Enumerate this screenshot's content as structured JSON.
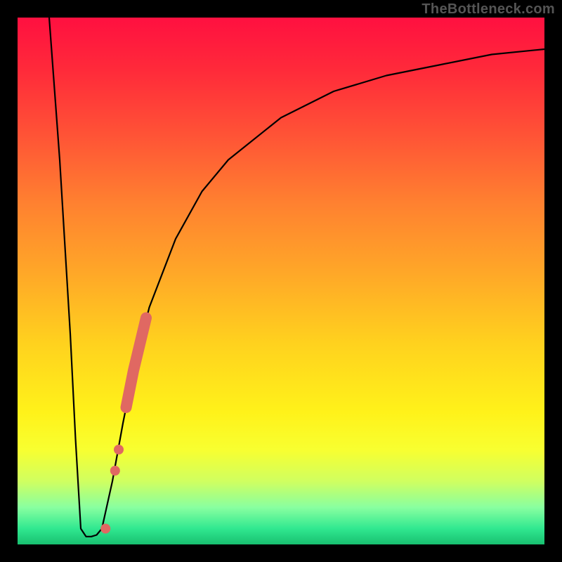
{
  "watermark": "TheBottleneck.com",
  "chart_data": {
    "type": "line",
    "title": "",
    "xlabel": "",
    "ylabel": "",
    "xlim": [
      0,
      100
    ],
    "ylim": [
      0,
      100
    ],
    "series": [
      {
        "name": "curve-left-descent",
        "x": [
          6,
          8,
          10,
          11,
          12
        ],
        "values": [
          100,
          73,
          40,
          20,
          3
        ]
      },
      {
        "name": "curve-valley",
        "x": [
          12,
          13,
          14,
          15,
          16
        ],
        "values": [
          3,
          1.5,
          1.5,
          1.8,
          3
        ]
      },
      {
        "name": "curve-right-rise",
        "x": [
          16,
          18,
          20,
          22,
          25,
          30,
          35,
          40,
          50,
          60,
          70,
          80,
          90,
          100
        ],
        "values": [
          3,
          12,
          23,
          33,
          45,
          58,
          67,
          73,
          81,
          86,
          89,
          91,
          93,
          94
        ]
      }
    ],
    "markers": [
      {
        "x": 16.7,
        "y": 3,
        "size": 7
      },
      {
        "x": 18.5,
        "y": 14,
        "size": 7
      },
      {
        "x": 19.2,
        "y": 18,
        "size": 7
      },
      {
        "x": 20.6,
        "y": 26,
        "size": 10
      },
      {
        "x": 22.0,
        "y": 33,
        "size": 10
      },
      {
        "x": 23.2,
        "y": 38,
        "size": 10
      },
      {
        "x": 24.4,
        "y": 43,
        "size": 10
      }
    ],
    "marker_color": "#e06862"
  }
}
